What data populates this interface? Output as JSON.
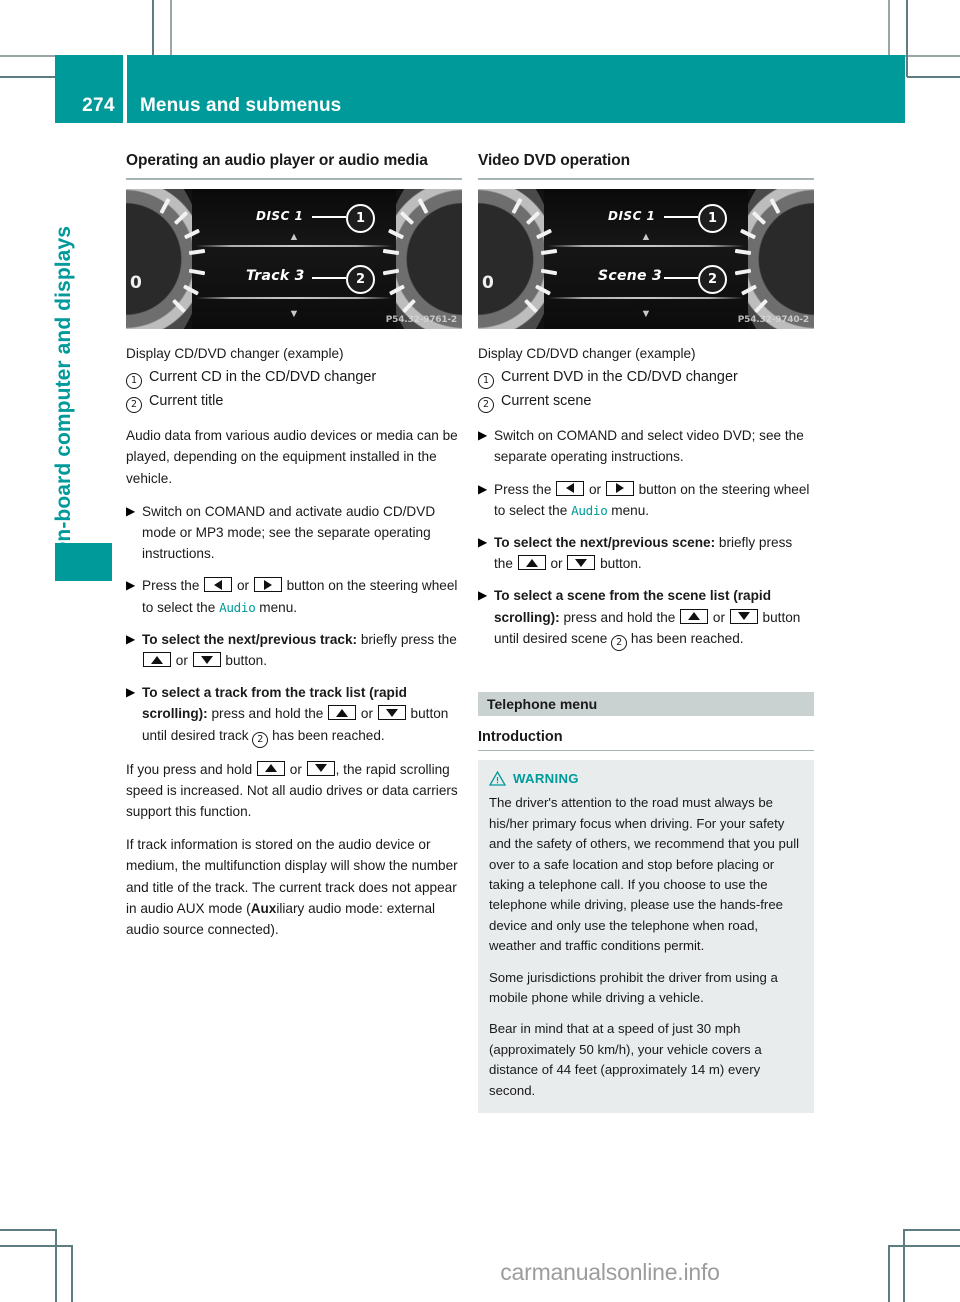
{
  "header": {
    "page_number": "274",
    "title": "Menus and submenus",
    "accent_color": "#009a9b"
  },
  "sidebar": {
    "chapter_label": "On-board computer and displays",
    "tab_color": "#009a9b"
  },
  "left_column": {
    "section_title": "Operating an audio player or audio media",
    "figure": {
      "disc_text": "DISC 1",
      "track_text": "Track 3",
      "callout_1": "1",
      "callout_2": "2",
      "watermark": "P54.32-9761-2"
    },
    "caption": "Display CD/DVD changer (example)",
    "legend": [
      {
        "num": ":",
        "text": "Current CD in the CD/DVD changer"
      },
      {
        "num": ";",
        "text": "Current title"
      }
    ],
    "intro_paragraph": "Audio data from various audio devices or media can be played, depending on the equipment installed in the vehicle.",
    "steps": [
      {
        "bullet": "X",
        "parts": [
          {
            "type": "text",
            "value": "Switch on COMAND and activate audio CD/DVD mode or MP3 mode; see the separate operating instructions."
          }
        ]
      },
      {
        "bullet": "X",
        "parts": [
          {
            "type": "text",
            "value": "Press the "
          },
          {
            "type": "key",
            "value": "left"
          },
          {
            "type": "text",
            "value": " or "
          },
          {
            "type": "key",
            "value": "right"
          },
          {
            "type": "text",
            "value": " button on the steering wheel to select the "
          },
          {
            "type": "menu",
            "value": "Audio"
          },
          {
            "type": "text",
            "value": " menu."
          }
        ]
      },
      {
        "bullet": "X",
        "parts": [
          {
            "type": "bold",
            "value": "To select the next/previous track:"
          },
          {
            "type": "text",
            "value": " briefly press the "
          },
          {
            "type": "key",
            "value": "up"
          },
          {
            "type": "text",
            "value": " or "
          },
          {
            "type": "key",
            "value": "down"
          },
          {
            "type": "text",
            "value": " button."
          }
        ]
      },
      {
        "bullet": "X",
        "parts": [
          {
            "type": "bold",
            "value": "To select a track from the track list (rapid scrolling):"
          },
          {
            "type": "text",
            "value": " press and hold the "
          },
          {
            "type": "key",
            "value": "up"
          },
          {
            "type": "text",
            "value": " or "
          },
          {
            "type": "key",
            "value": "down"
          },
          {
            "type": "text",
            "value": " button until desired track "
          },
          {
            "type": "circle",
            "value": "2"
          },
          {
            "type": "text",
            "value": " has been reached."
          }
        ]
      }
    ],
    "note_parts": [
      {
        "type": "text",
        "value": "If you press and hold "
      },
      {
        "type": "key",
        "value": "up"
      },
      {
        "type": "text",
        "value": " or "
      },
      {
        "type": "key",
        "value": "down"
      },
      {
        "type": "text",
        "value": ", the rapid scrolling speed is increased. Not all audio drives or data carriers support this function."
      }
    ],
    "closing_parts": [
      {
        "type": "text",
        "value": "If track information is stored on the audio device or medium, the multifunction display will show the number and title of the track. The current track does not appear in audio AUX mode ("
      },
      {
        "type": "bold",
        "value": "Aux"
      },
      {
        "type": "text",
        "value": "iliary audio mode: external audio source connected)."
      }
    ]
  },
  "right_column": {
    "section_title": "Video DVD operation",
    "figure": {
      "disc_text": "DISC 1",
      "scene_text": "Scene 3",
      "callout_1": "1",
      "callout_2": "2",
      "watermark": "P54.32-9740-2"
    },
    "caption": "Display CD/DVD changer (example)",
    "legend": [
      {
        "num": ":",
        "text": "Current DVD in the CD/DVD changer"
      },
      {
        "num": ";",
        "text": "Current scene"
      }
    ],
    "steps": [
      {
        "bullet": "X",
        "parts": [
          {
            "type": "text",
            "value": "Switch on COMAND and select video DVD; see the separate operating instructions."
          }
        ]
      },
      {
        "bullet": "X",
        "parts": [
          {
            "type": "text",
            "value": "Press the "
          },
          {
            "type": "key",
            "value": "left"
          },
          {
            "type": "text",
            "value": " or "
          },
          {
            "type": "key",
            "value": "right"
          },
          {
            "type": "text",
            "value": " button on the steering wheel to select the "
          },
          {
            "type": "menu",
            "value": "Audio"
          },
          {
            "type": "text",
            "value": " menu."
          }
        ]
      },
      {
        "bullet": "X",
        "parts": [
          {
            "type": "bold",
            "value": "To select the next/previous scene:"
          },
          {
            "type": "text",
            "value": " briefly press the "
          },
          {
            "type": "key",
            "value": "up"
          },
          {
            "type": "text",
            "value": " or "
          },
          {
            "type": "key",
            "value": "down"
          },
          {
            "type": "text",
            "value": " button."
          }
        ]
      },
      {
        "bullet": "X",
        "parts": [
          {
            "type": "bold",
            "value": "To select a scene from the scene list (rapid scrolling):"
          },
          {
            "type": "text",
            "value": " press and hold the "
          },
          {
            "type": "key",
            "value": "up"
          },
          {
            "type": "text",
            "value": " or "
          },
          {
            "type": "key",
            "value": "down"
          },
          {
            "type": "text",
            "value": " button until desired scene "
          },
          {
            "type": "circle",
            "value": "2"
          },
          {
            "type": "text",
            "value": " has been reached."
          }
        ]
      }
    ],
    "band_title": "Telephone menu",
    "sub_title": "Introduction",
    "warning": {
      "icon": "warning-triangle-icon",
      "label": "WARNING",
      "accent_color": "#009a9b",
      "paragraphs": [
        "The driver's attention to the road must always be his/her primary focus when driving. For your safety and the safety of others, we recommend that you pull over to a safe location and stop before placing or taking a telephone call. If you choose to use the telephone while driving, please use the hands-free device and only use the telephone when road, weather and traffic conditions permit.",
        "Some jurisdictions prohibit the driver from using a mobile phone while driving a vehicle.",
        "Bear in mind that at a speed of just 30 mph (approximately 50 km/h), your vehicle covers a distance of 44 feet (approximately 14 m) every second."
      ]
    }
  },
  "footer": {
    "watermark": "carmanualsonline.info"
  }
}
